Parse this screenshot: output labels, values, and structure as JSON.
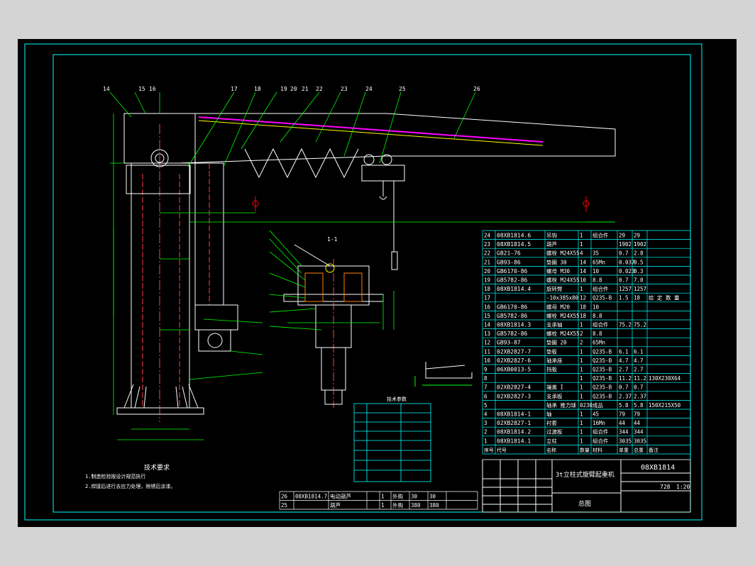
{
  "drawing_number": "08XB1814",
  "title_block": {
    "name": "3t立柱式旋臂起重机",
    "mass": "728",
    "scale": "1:20",
    "sheet_label": "总图"
  },
  "tech_requirements": {
    "heading": "技术要求",
    "line1": "1.制造检验按设计规范执行",
    "line2": "2.焊接后进行去应力处理，除锈后涂漆。"
  },
  "section_label": "1-1",
  "callout_numbers": [
    "14",
    "15",
    "16",
    "17",
    "18",
    "19",
    "20",
    "21",
    "22",
    "23",
    "24",
    "25",
    "26"
  ],
  "bom_rows": [
    {
      "no": "24",
      "code": "08XB1814.6",
      "name": "吊钩",
      "qty": "1",
      "material": "组合件",
      "unit": "29",
      "total": "29",
      "note": ""
    },
    {
      "no": "23",
      "code": "08XB1814.5",
      "name": "葫芦",
      "qty": "1",
      "material": "",
      "unit": "1902",
      "total": "1902",
      "note": ""
    },
    {
      "no": "22",
      "code": "GB21-76",
      "name": "螺栓 M24X55",
      "qty": "4",
      "material": "35",
      "unit": "0.7",
      "total": "2.8",
      "note": ""
    },
    {
      "no": "21",
      "code": "GB93-86",
      "name": "垫圈 30",
      "qty": "14",
      "material": "65Mn",
      "unit": "0.037",
      "total": "0.5",
      "note": ""
    },
    {
      "no": "20",
      "code": "GB6170-86",
      "name": "螺母 M30",
      "qty": "14",
      "material": "10",
      "unit": "0.023",
      "total": "0.3",
      "note": ""
    },
    {
      "no": "19",
      "code": "GB5782-86",
      "name": "螺栓 M24X55",
      "qty": "10",
      "material": "8.8",
      "unit": "0.7",
      "total": "7.0",
      "note": ""
    },
    {
      "no": "18",
      "code": "08XB1814.4",
      "name": "旋转臂",
      "qty": "1",
      "material": "组合件",
      "unit": "1257",
      "total": "1257",
      "note": ""
    },
    {
      "no": "17",
      "code": "",
      "name": "-10x385x80",
      "qty": "12",
      "material": "Q235-B",
      "unit": "1.5",
      "total": "18",
      "note": "给 定 数 量"
    },
    {
      "no": "16",
      "code": "GB6170-86",
      "name": "螺母 M20",
      "qty": "18",
      "material": "10",
      "unit": "",
      "total": "",
      "note": ""
    },
    {
      "no": "15",
      "code": "GB5782-86",
      "name": "螺栓 M24X55",
      "qty": "18",
      "material": "8.8",
      "unit": "",
      "total": "",
      "note": ""
    },
    {
      "no": "14",
      "code": "08XB1814.3",
      "name": "支承轴",
      "qty": "1",
      "material": "组合件",
      "unit": "75.2",
      "total": "75.2",
      "note": ""
    },
    {
      "no": "13",
      "code": "GB5782-86",
      "name": "螺栓 M24X55",
      "qty": "2",
      "material": "8.8",
      "unit": "",
      "total": "",
      "note": ""
    },
    {
      "no": "12",
      "code": "GB93-87",
      "name": "垫圈 20",
      "qty": "2",
      "material": "65Mn",
      "unit": "",
      "total": "",
      "note": ""
    },
    {
      "no": "11",
      "code": "02XB2827-7",
      "name": "垫板",
      "qty": "1",
      "material": "Q235-B",
      "unit": "6.1",
      "total": "6.1",
      "note": ""
    },
    {
      "no": "10",
      "code": "02XB2827-6",
      "name": "轴承座",
      "qty": "1",
      "material": "Q235-B",
      "unit": "4.7",
      "total": "4.7",
      "note": ""
    },
    {
      "no": "9",
      "code": "06XB0013-5",
      "name": "挡板",
      "qty": "1",
      "material": "Q235-B",
      "unit": "2.7",
      "total": "2.7",
      "note": ""
    },
    {
      "no": "8",
      "code": "",
      "name": "",
      "qty": "1",
      "material": "Q235-B",
      "unit": "11.2",
      "total": "11.2",
      "note": "130X230X64"
    },
    {
      "no": "7",
      "code": "02XB2827-4",
      "name": "端盖 I",
      "qty": "1",
      "material": "Q235-B",
      "unit": "0.7",
      "total": "0.7",
      "note": ""
    },
    {
      "no": "6",
      "code": "02XB2827-3",
      "name": "支承板",
      "qty": "1",
      "material": "Q235-B",
      "unit": "2.37",
      "total": "2.37",
      "note": ""
    },
    {
      "no": "5",
      "code": "",
      "name": "轴承 推力球",
      "qty": "0230",
      "material": "成品",
      "unit": "5.8",
      "total": "5.8",
      "note": "150X215X50"
    },
    {
      "no": "4",
      "code": "08XB1814-1",
      "name": "轴",
      "qty": "1",
      "material": "45",
      "unit": "79",
      "total": "79",
      "note": ""
    },
    {
      "no": "3",
      "code": "02XB2827-1",
      "name": "衬套",
      "qty": "1",
      "material": "16Mn",
      "unit": "44",
      "total": "44",
      "note": ""
    },
    {
      "no": "2",
      "code": "08XB1814.2",
      "name": "过渡板",
      "qty": "1",
      "material": "组合件",
      "unit": "344",
      "total": "344",
      "note": ""
    },
    {
      "no": "1",
      "code": "08XB1814.1",
      "name": "立柱",
      "qty": "1",
      "material": "组合件",
      "unit": "3035",
      "total": "3035",
      "note": ""
    }
  ],
  "bom_header": {
    "no": "序号",
    "code": "代号",
    "name": "名称",
    "qty": "数量",
    "material": "材料",
    "unit": "单重",
    "total": "总重",
    "note": "备注"
  },
  "extra_rows": [
    {
      "no": "26",
      "code": "08XB1814.7",
      "name": "电动葫芦",
      "qty": "1",
      "material": "外购",
      "unit": "30",
      "total": "30"
    },
    {
      "no": "25",
      "code": "",
      "name": "葫芦",
      "qty": "1",
      "material": "外购",
      "unit": "380",
      "total": "380"
    }
  ],
  "params_title": "技术参数",
  "colors": {
    "bg": "#000000",
    "frame": "#00ffff",
    "line": "#ffffff",
    "dim": "#00ff00",
    "accent": "#ff0000",
    "magenta": "#ff00ff",
    "yellow": "#ffff00",
    "blue": "#4040ff"
  }
}
